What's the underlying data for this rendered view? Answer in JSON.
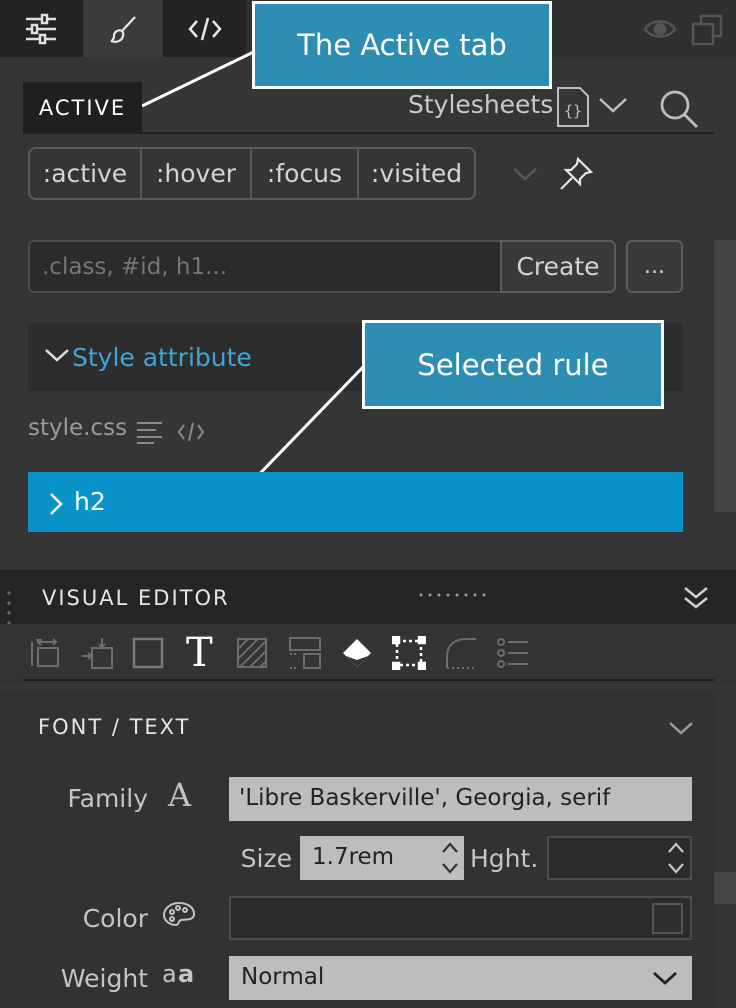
{
  "callouts": {
    "active_tab": "The Active tab",
    "selected_rule": "Selected rule"
  },
  "active_tab": {
    "label": "ACTIVE",
    "stylesheets_label": "Stylesheets"
  },
  "pseudo_classes": [
    ":active",
    ":hover",
    ":focus",
    ":visited"
  ],
  "selector": {
    "placeholder": ".class, #id, h1...",
    "create_label": "Create",
    "more_label": "..."
  },
  "rules": {
    "style_attribute_label": "Style attribute",
    "stylesheet_name": "style.css",
    "selected_rule": "h2"
  },
  "visual_editor": {
    "title": "VISUAL EDITOR",
    "section_title": "FONT / TEXT"
  },
  "font_props": {
    "family_label": "Family",
    "family_value": "'Libre Baskerville', Georgia, serif",
    "size_label": "Size",
    "size_value": "1.7rem",
    "height_label": "Hght.",
    "height_value": "",
    "color_label": "Color",
    "weight_label": "Weight",
    "weight_value": "Normal"
  },
  "colors": {
    "accent": "#0993c8",
    "link": "#3ea7d8",
    "callout": "#2e8db2"
  }
}
